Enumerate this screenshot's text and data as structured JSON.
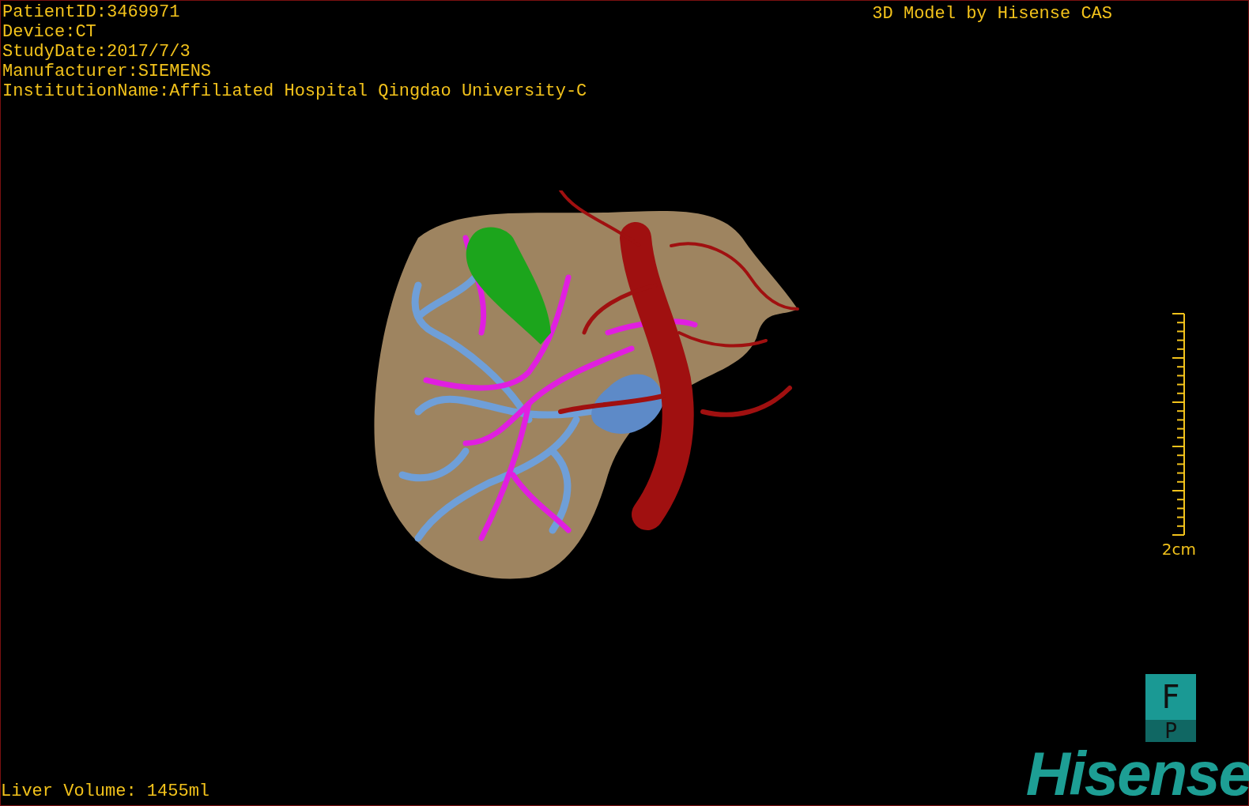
{
  "patient_info": [
    "PatientID:3469971",
    "Device:CT",
    "StudyDate:2017/7/3",
    "Manufacturer:SIEMENS",
    "InstitutionName:Affiliated Hospital Qingdao University-C"
  ],
  "title": "3D Model by Hisense CAS",
  "scale_bar": {
    "label": "2cm"
  },
  "liver_volume": "Liver Volume: 1455ml",
  "orientation_cube": {
    "faces": [
      "F",
      "P"
    ]
  },
  "logo": "Hisense"
}
